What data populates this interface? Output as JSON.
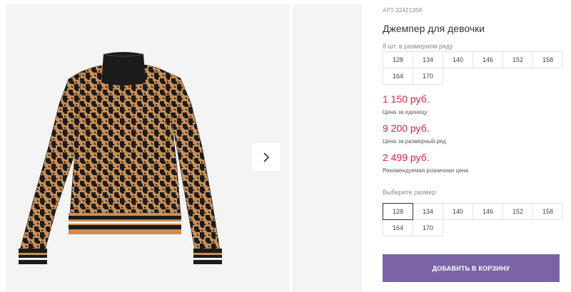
{
  "product": {
    "article_prefix": "АРТ:",
    "article_code": "32421358",
    "title": "Джемпер для девочки",
    "pack_note": "8 шт. в размерном ряду",
    "pack_sizes": [
      "128",
      "134",
      "140",
      "146",
      "152",
      "158",
      "164",
      "170"
    ]
  },
  "prices": [
    {
      "value": "1 150 руб.",
      "caption": "Цена за единицу"
    },
    {
      "value": "9 200 руб.",
      "caption": "Цена за размерный ряд"
    },
    {
      "value": "2 499 руб.",
      "caption": "Рекомендуемая розничная цена"
    }
  ],
  "size_select": {
    "label": "Выберите размер:",
    "options": [
      "128",
      "134",
      "140",
      "146",
      "152",
      "158",
      "164",
      "170"
    ],
    "selected": "128"
  },
  "cart_button": {
    "label": "ДОБАВИТЬ В КОРЗИНУ"
  },
  "gallery": {
    "next_icon": "chevron-right-icon"
  },
  "colors": {
    "price": "#e3213a",
    "accent": "#7a64a6",
    "sweater_base": "#c98f55",
    "sweater_pattern": "#1b1b1b"
  }
}
